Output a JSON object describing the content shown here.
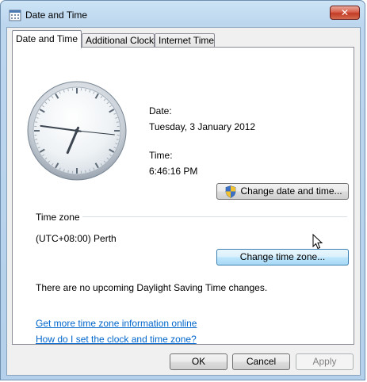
{
  "window": {
    "title": "Date and Time",
    "title_icon": "date-time-icon",
    "close_icon": "close-icon",
    "close_glyph": "✕"
  },
  "tabs": [
    {
      "label": "Date and Time",
      "active": true
    },
    {
      "label": "Additional Clocks",
      "active": false
    },
    {
      "label": "Internet Time",
      "active": false
    }
  ],
  "clock": {
    "hours": 6,
    "minutes": 46,
    "seconds": 16
  },
  "date": {
    "label": "Date:",
    "value": "Tuesday, 3 January 2012"
  },
  "time": {
    "label": "Time:",
    "value": "6:46:16 PM"
  },
  "change_datetime_button": "Change date and time...",
  "timezone": {
    "section_label": "Time zone",
    "value": "(UTC+08:00) Perth",
    "change_button": "Change time zone...",
    "dst_message": "There are no upcoming Daylight Saving Time changes."
  },
  "links": {
    "more_info": "Get more time zone information online",
    "how_to_set": "How do I set the clock and time zone?"
  },
  "buttons": {
    "ok": "OK",
    "cancel": "Cancel",
    "apply": "Apply"
  },
  "colors": {
    "link": "#0066cc",
    "close_button": "#c23b24",
    "focus_button": "#3c7fb1"
  }
}
